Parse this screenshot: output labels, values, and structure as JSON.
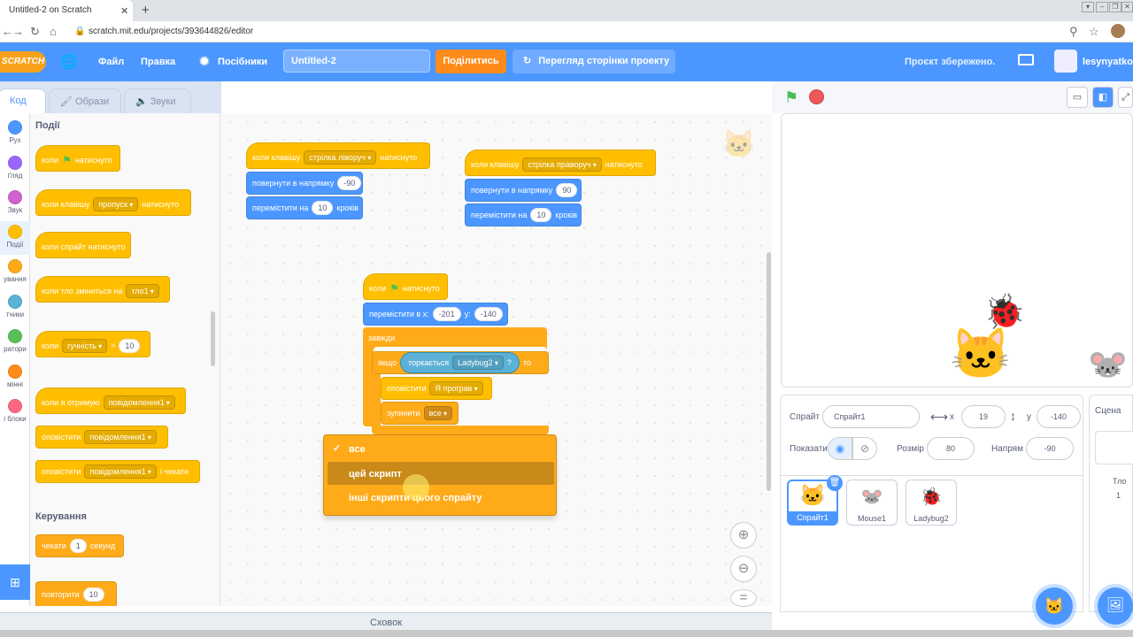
{
  "browser": {
    "tab_title": "Untitled-2 on Scratch",
    "url": "scratch.mit.edu/projects/393644826/editor"
  },
  "menubar": {
    "logo": "SCRATCH",
    "file": "Файл",
    "edit": "Правка",
    "tutorials": "Посібники",
    "project_title": "Untitled-2",
    "share": "Поділитись",
    "see_project_page": "Перегляд сторінки проекту",
    "save_status": "Проєкт збережено.",
    "username": "lesynyatko"
  },
  "editor_tabs": {
    "code": "Код",
    "costumes": "Образи",
    "sounds": "Звуки"
  },
  "categories": [
    {
      "label": "Рух",
      "color": "#4c97ff"
    },
    {
      "label": "ґляд",
      "color": "#9966ff"
    },
    {
      "label": "Звук",
      "color": "#cf63cf"
    },
    {
      "label": "Події",
      "color": "#ffbf00"
    },
    {
      "label": "ування",
      "color": "#ffab19"
    },
    {
      "label": "тчики",
      "color": "#5cb1d6"
    },
    {
      "label": "ратори",
      "color": "#59c059"
    },
    {
      "label": "мінні",
      "color": "#ff8c1a"
    },
    {
      "label": "і блоки",
      "color": "#ff6680"
    }
  ],
  "palette": {
    "events_heading": "Події",
    "control_heading": "Керування",
    "when_flag_a": "коли",
    "when_flag_b": "натиснуто",
    "when_key_a": "коли клавішу",
    "when_key_dd": "пропуск",
    "when_key_b": "натиснуто",
    "when_sprite_clicked": "коли спрайт натиснуто",
    "when_backdrop_a": "коли тло зміниться на",
    "when_backdrop_dd": "тло1",
    "when_loudness_a": "коли",
    "when_loudness_dd": "гучність",
    "when_loudness_op": ">",
    "when_loudness_val": "10",
    "when_receive_a": "коли я отримую",
    "when_receive_dd": "повідомлення1",
    "broadcast_a": "оповістити",
    "broadcast_dd": "повідомлення1",
    "broadcast_wait_a": "оповістити",
    "broadcast_wait_dd": "повідомлення1",
    "broadcast_wait_b": "і чекати",
    "wait_a": "чекати",
    "wait_val": "1",
    "wait_b": "секунд",
    "repeat_a": "повторити",
    "repeat_val": "10"
  },
  "scripts": {
    "s1_hat_a": "коли клавішу",
    "s1_hat_dd": "стрілка ліворуч",
    "s1_hat_b": "натиснуто",
    "s1_turn_a": "повернути в напрямку",
    "s1_turn_val": "-90",
    "s1_move_a": "перемістити на",
    "s1_move_val": "10",
    "s1_move_b": "кроків",
    "s2_hat_a": "коли клавішу",
    "s2_hat_dd": "стрілка праворуч",
    "s2_hat_b": "натиснуто",
    "s2_turn_a": "повернути в напрямку",
    "s2_turn_val": "90",
    "s2_move_a": "перемістити на",
    "s2_move_val": "10",
    "s2_move_b": "кроків",
    "s3_hat_a": "коли",
    "s3_hat_b": "натиснуто",
    "s3_goto_a": "перемістити в x:",
    "s3_goto_x": "-201",
    "s3_goto_b": "y:",
    "s3_goto_y": "-140",
    "s3_forever": "завжди",
    "s3_if_a": "якщо",
    "s3_touch_a": "торкається",
    "s3_touch_dd": "Ladybug2",
    "s3_touch_q": "?",
    "s3_if_b": "то",
    "s3_broadcast_a": "оповістити",
    "s3_broadcast_dd": "Я програв",
    "s3_stop_a": "зупинити",
    "s3_stop_dd": "все"
  },
  "dropdown_menu": {
    "options": [
      "все",
      "цей скрипт",
      "інші скрипти цього спрайту"
    ],
    "selected": "все",
    "hovered": "цей скрипт"
  },
  "backpack": "Сховок",
  "sprite_info": {
    "sprite_label": "Спрайт",
    "sprite_name": "Спрайт1",
    "x_label": "x",
    "x": "19",
    "y_label": "y",
    "y": "-140",
    "show_label": "Показати",
    "size_label": "Розмір",
    "size": "80",
    "direction_label": "Напрям",
    "direction": "-90"
  },
  "sprites": [
    {
      "name": "Спрайт1",
      "selected": true
    },
    {
      "name": "Mouse1",
      "selected": false
    },
    {
      "name": "Ladybug2",
      "selected": false
    }
  ],
  "stage_pane": {
    "title": "Сцена",
    "backdrops_label": "Тло",
    "backdrops_count": "1"
  }
}
